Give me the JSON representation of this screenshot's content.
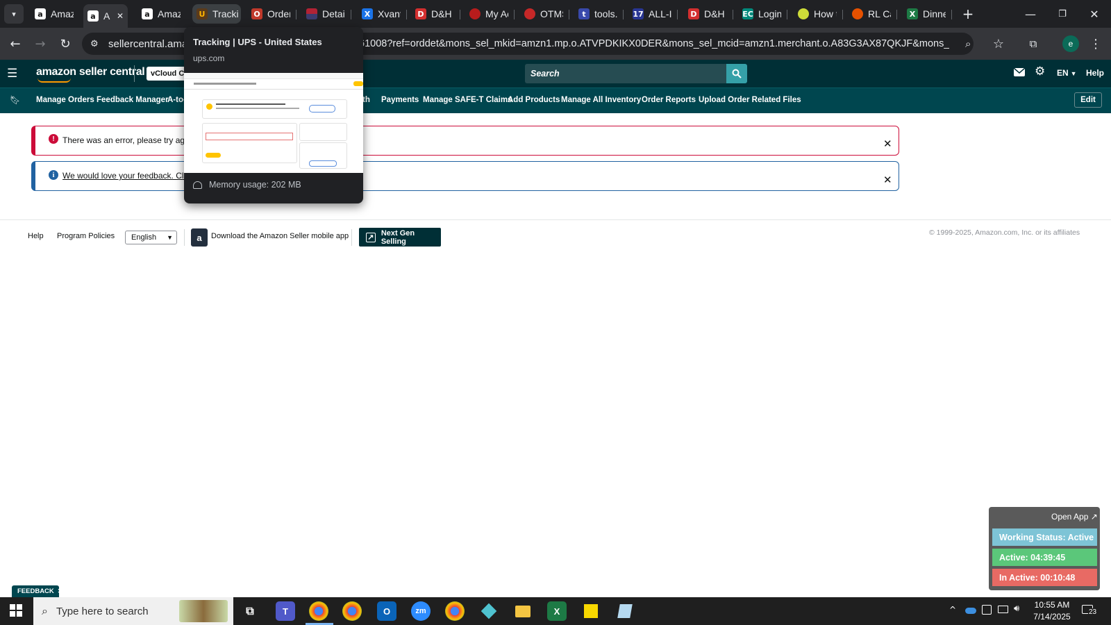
{
  "browser": {
    "tabs": [
      {
        "label": "Amaz",
        "icon": "amazon-icon",
        "state": "normal"
      },
      {
        "label": "A",
        "icon": "amazon-icon",
        "state": "active"
      },
      {
        "label": "Amaz",
        "icon": "amazon-icon",
        "state": "normal"
      },
      {
        "label": "Tracki",
        "icon": "ups-icon",
        "state": "hover"
      },
      {
        "label": "Order",
        "icon": "order-icon",
        "state": "normal"
      },
      {
        "label": "Detail",
        "icon": "flag-icon",
        "state": "normal"
      },
      {
        "label": "Xvant",
        "icon": "xvant-icon",
        "state": "normal"
      },
      {
        "label": "D&H",
        "icon": "dh-icon",
        "state": "normal"
      },
      {
        "label": "My Ac",
        "icon": "link-icon",
        "state": "normal"
      },
      {
        "label": "OTMS",
        "icon": "otms-icon",
        "state": "normal"
      },
      {
        "label": "tools.",
        "icon": "tools-icon",
        "state": "normal"
      },
      {
        "label": "ALL-I",
        "icon": "seventeen-icon",
        "state": "normal"
      },
      {
        "label": "D&H",
        "icon": "dh-icon",
        "state": "normal"
      },
      {
        "label": "Login",
        "icon": "ec-icon",
        "state": "normal"
      },
      {
        "label": "How t",
        "icon": "circle-icon",
        "state": "normal"
      },
      {
        "label": "RL Ca",
        "icon": "rl-icon",
        "state": "normal"
      },
      {
        "label": "Dinne",
        "icon": "excel-icon",
        "state": "normal"
      }
    ],
    "url_left": "sellercentral.amaz",
    "url_right": "61008?ref=orddet&mons_sel_mkid=amzn1.mp.o.ATVPDKIKX0DER&mons_sel_mcid=amzn1.merchant.o.A83G3AX87QKJF&mons_sel_persi...",
    "profile_initial": "e"
  },
  "tooltip": {
    "title": "Tracking | UPS - United States",
    "domain": "ups.com",
    "memory": "Memory usage: 202 MB"
  },
  "header": {
    "logo": "amazon seller central",
    "store": "vCloud Ch",
    "search_placeholder": "Search",
    "lang": "EN",
    "help": "Help"
  },
  "nav": {
    "items": [
      "Manage Orders",
      "Feedback Manager",
      "A-to-",
      "th",
      "Payments",
      "Manage SAFE-T Claims",
      "Add Products",
      "Manage All Inventory",
      "Order Reports",
      "Upload Order Related Files"
    ],
    "edit": "Edit"
  },
  "alerts": {
    "error": "There was an error, please try agai",
    "info": "We would love your feedback. Clic"
  },
  "footer": {
    "help": "Help",
    "policies": "Program Policies",
    "language": "English",
    "mobile_app": "Download the Amazon Seller mobile app",
    "next_gen": "Next Gen Selling",
    "copyright": "© 1999-2025, Amazon.com, Inc. or its affiliates"
  },
  "feedback_tab": "FEEDBACK",
  "widget": {
    "open_app": "Open App ↗",
    "working_status": "Working Status: Active",
    "active": "Active: 04:39:45",
    "inactive": "In Active: 00:10:48"
  },
  "taskbar": {
    "search_placeholder": "Type here to search",
    "time": "10:55 AM",
    "date": "7/14/2025",
    "notification_count": "23"
  },
  "colors": {
    "amazon_dark": "#002f36",
    "amazon_nav": "#00464f",
    "error_red": "#cc0c39",
    "info_blue": "#2162a1",
    "active_green": "#5bc77a",
    "inactive_red": "#e86a64",
    "status_teal": "#7ec4d6"
  }
}
